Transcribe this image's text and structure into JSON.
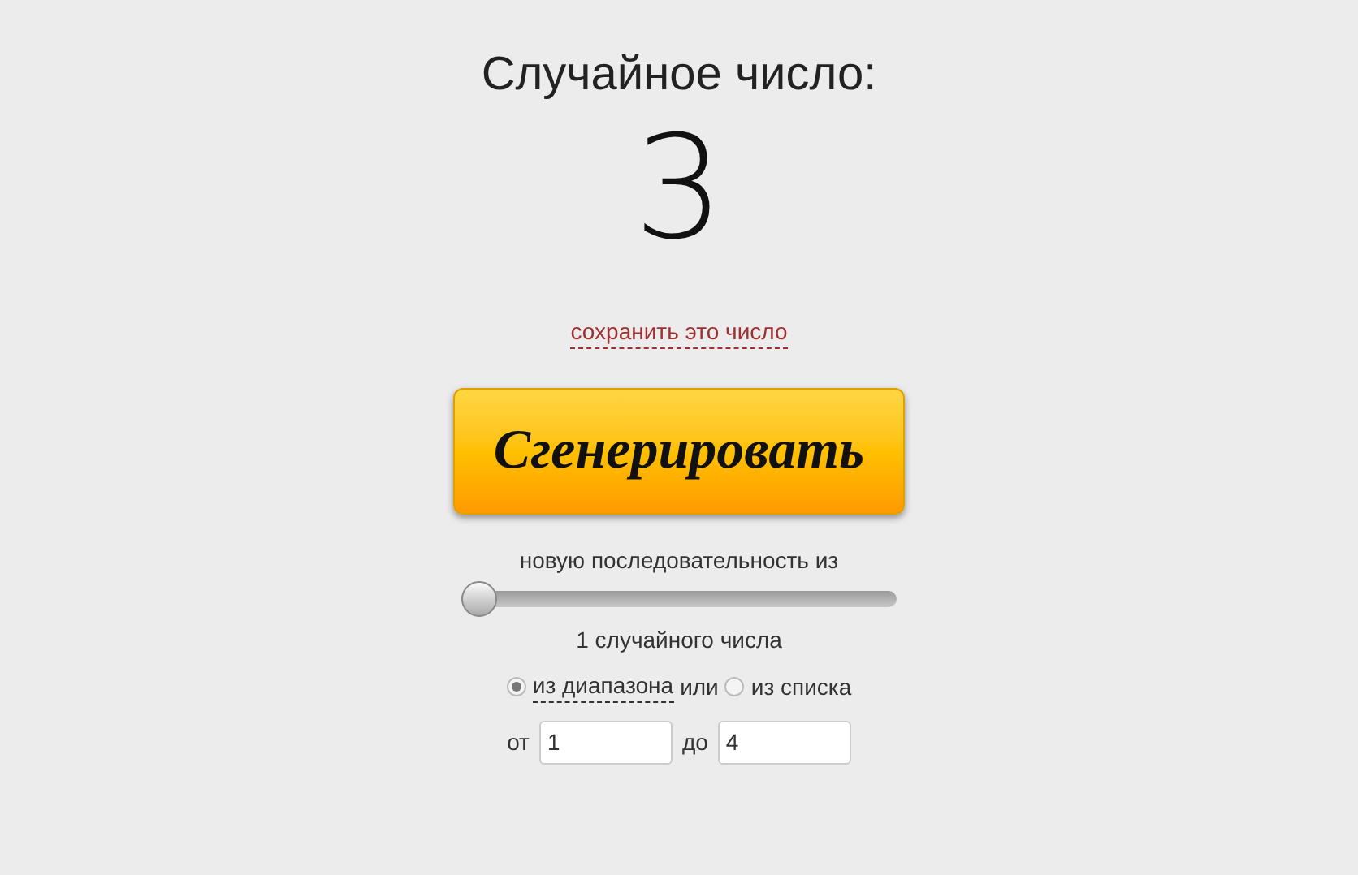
{
  "title": "Случайное число:",
  "result": "3",
  "save_link": "сохранить это число",
  "generate_button": "Сгенерировать",
  "sequence_label": "новую последовательность из",
  "count_slider": {
    "level": 0
  },
  "count_label": "1 случайного числа",
  "source_options": [
    {
      "label": "из диапазона",
      "selected": true
    },
    {
      "label": "из списка",
      "selected": false
    }
  ],
  "or_text": "или",
  "range": {
    "from_label": "от",
    "from_value": "1",
    "to_label": "до",
    "to_value": "4"
  }
}
